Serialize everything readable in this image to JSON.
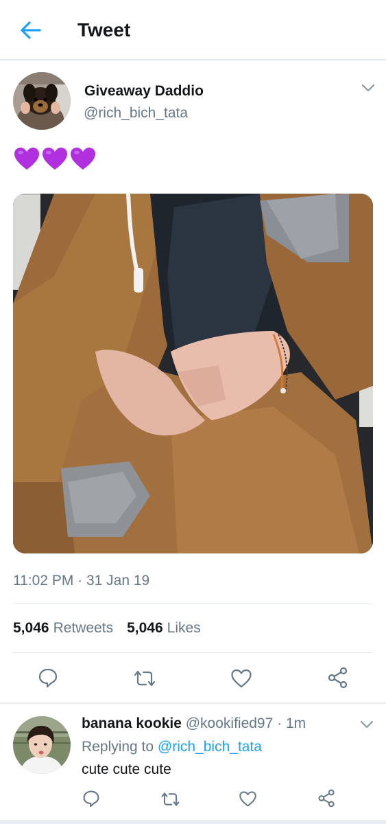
{
  "header": {
    "title": "Tweet"
  },
  "tweet": {
    "author_name": "Giveaway Daddio",
    "author_handle": "@rich_bich_tata",
    "text_emojis": [
      "purple-heart",
      "purple-heart",
      "purple-heart"
    ],
    "timestamp": "11:02 PM · 31 Jan 19",
    "retweets_count": "5,046",
    "retweets_label": "Retweets",
    "likes_count": "5,046",
    "likes_label": "Likes"
  },
  "reply": {
    "author_name": "banana kookie",
    "author_handle": "@kookified97",
    "separator": "·",
    "time": "1m",
    "replying_prefix": "Replying to",
    "replying_to": "@rich_bich_tata",
    "text": "cute cute cute"
  },
  "colors": {
    "accent": "#1da1f2",
    "secondary_text": "#657786",
    "divider": "#e1e8ed",
    "heart_purple": "#b030e0"
  },
  "icons": [
    "back-arrow-icon",
    "chevron-down-icon",
    "reply-icon",
    "retweet-icon",
    "like-icon",
    "share-icon"
  ]
}
